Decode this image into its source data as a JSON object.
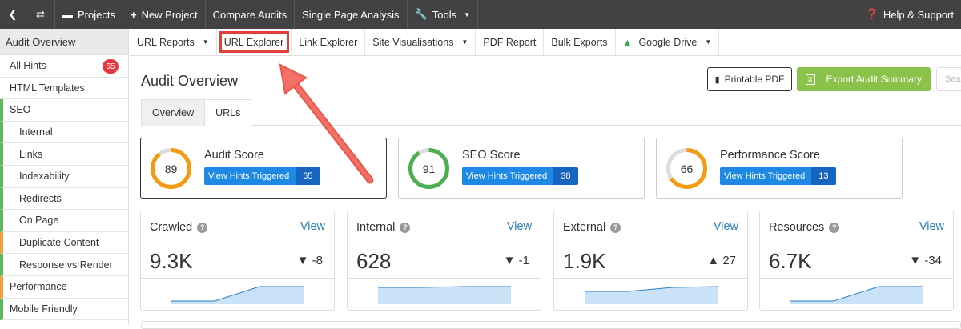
{
  "topbar": {
    "projects": "Projects",
    "new_project": "New Project",
    "compare_audits": "Compare Audits",
    "single_page_analysis": "Single Page Analysis",
    "tools": "Tools",
    "help": "Help & Support"
  },
  "sidebar": {
    "header": "Audit Overview",
    "all_hints": "All Hints",
    "all_hints_count": "65",
    "items": [
      "HTML Templates",
      "SEO",
      "Internal",
      "Links",
      "Indexability",
      "Redirects",
      "On Page",
      "Duplicate Content",
      "Response vs Render",
      "Performance",
      "Mobile Friendly"
    ]
  },
  "subnav": {
    "url_reports": "URL Reports",
    "url_explorer": "URL Explorer",
    "link_explorer": "Link Explorer",
    "site_visualisations": "Site Visualisations",
    "pdf_report": "PDF Report",
    "bulk_exports": "Bulk Exports",
    "google_drive": "Google Drive"
  },
  "main": {
    "title": "Audit Overview",
    "printable_pdf": "Printable PDF",
    "export_summary": "Export Audit Summary",
    "search_placeholder": "Search",
    "tabs": [
      "Overview",
      "URLs"
    ]
  },
  "scores": [
    {
      "title": "Audit Score",
      "value": "89",
      "hints_label": "View Hints Triggered",
      "hints_count": "65",
      "color": "#f39c12",
      "fraction": 0.89
    },
    {
      "title": "SEO Score",
      "value": "91",
      "hints_label": "View Hints Triggered",
      "hints_count": "38",
      "color": "#4caf50",
      "fraction": 0.91
    },
    {
      "title": "Performance Score",
      "value": "66",
      "hints_label": "View Hints Triggered",
      "hints_count": "13",
      "color": "#f39c12",
      "fraction": 0.66
    }
  ],
  "stats": [
    {
      "title": "Crawled",
      "view": "View",
      "value": "9.3K",
      "direction": "▼",
      "change": "-8"
    },
    {
      "title": "Internal",
      "view": "View",
      "value": "628",
      "direction": "▼",
      "change": "-1"
    },
    {
      "title": "External",
      "view": "View",
      "value": "1.9K",
      "direction": "▲",
      "change": "27"
    },
    {
      "title": "Resources",
      "view": "View",
      "value": "6.7K",
      "direction": "▼",
      "change": "-34"
    }
  ],
  "colors": {
    "topbar": "#424242",
    "accent_green": "#8bc34a",
    "hint_blue": "#1e88e5",
    "highlight_red": "#e0413b",
    "link_blue": "#2d7ec4"
  }
}
